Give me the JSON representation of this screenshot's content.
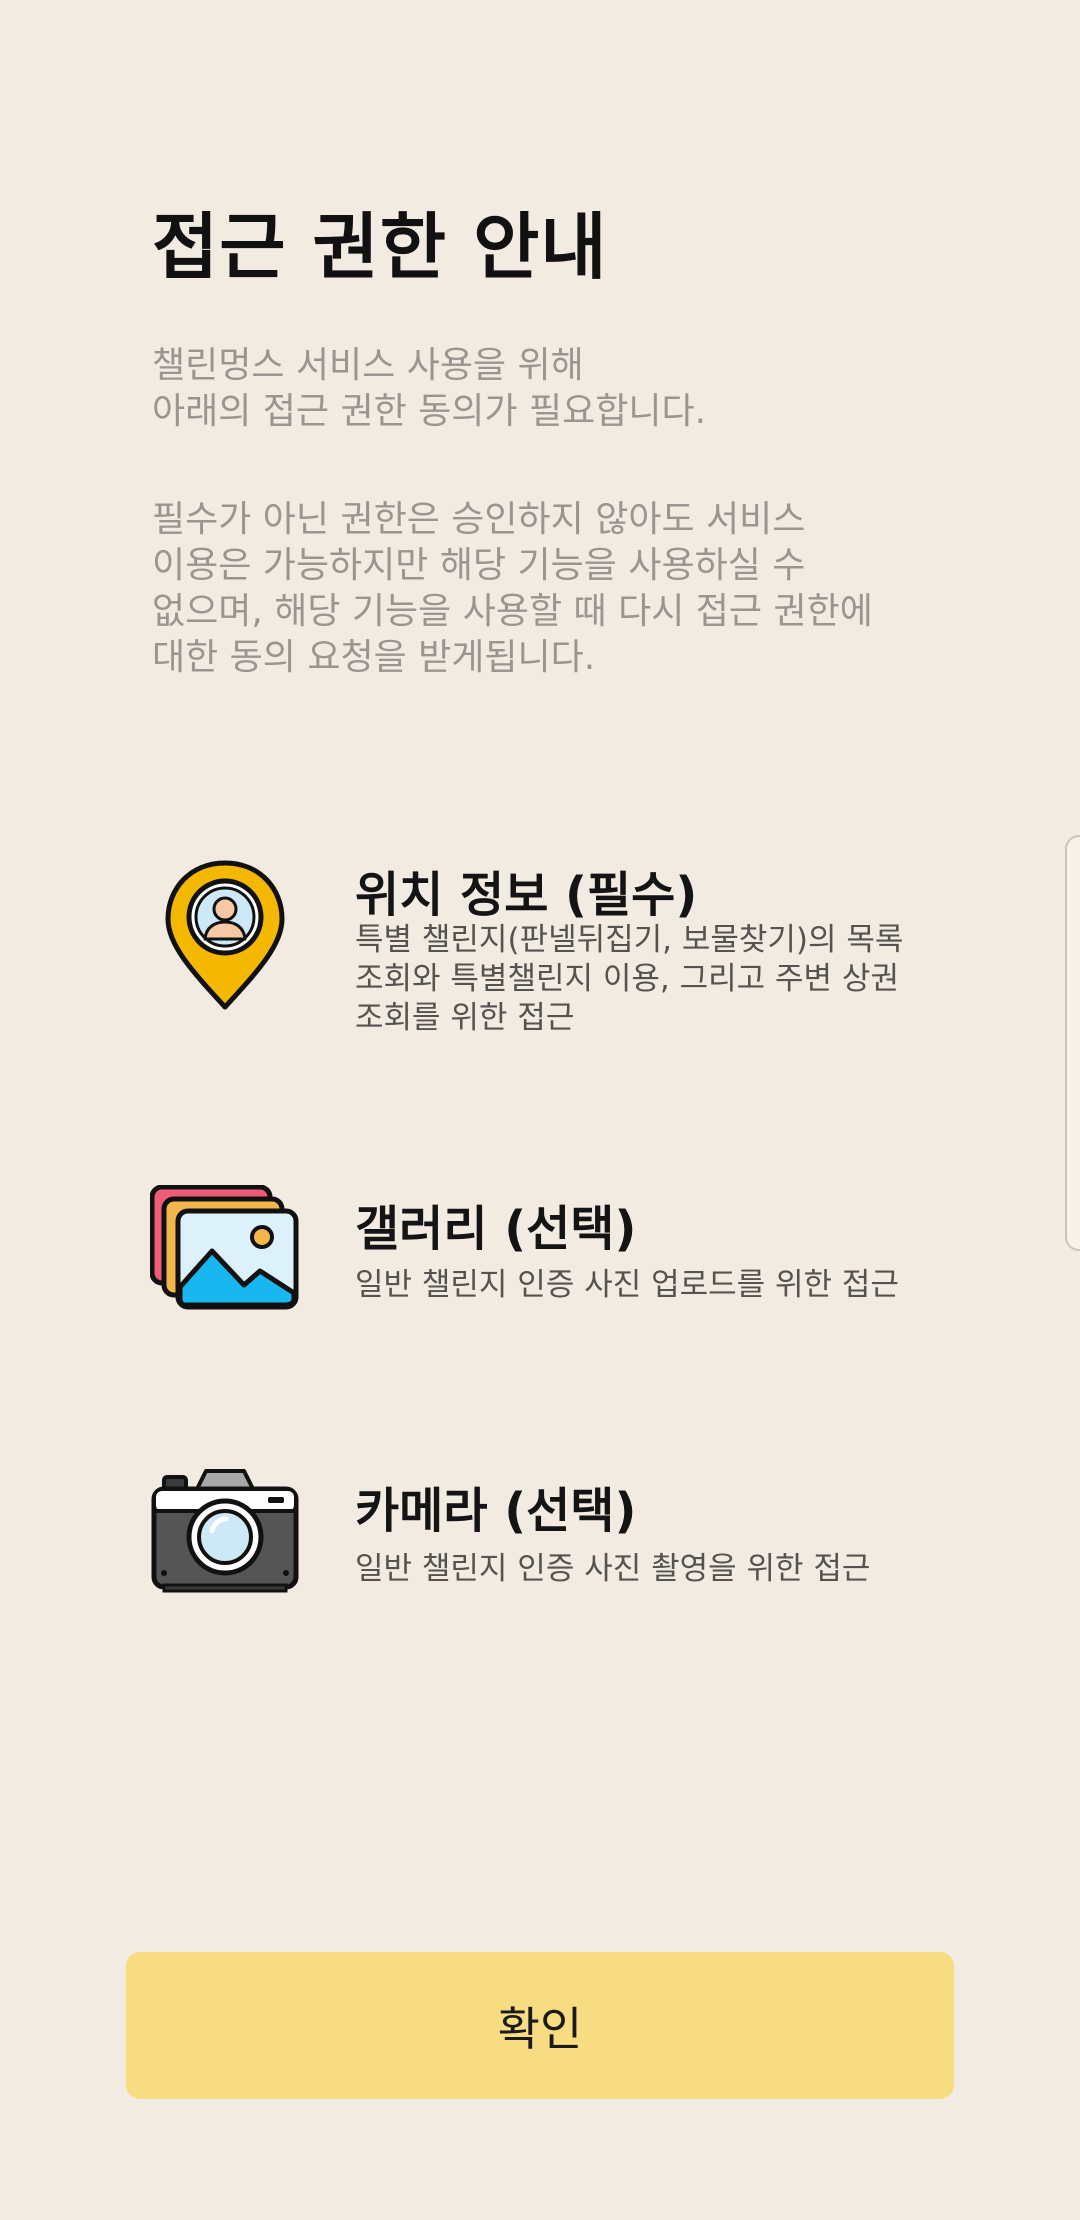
{
  "title": "접근 권한 안내",
  "intro": {
    "line1": "챌린멍스 서비스 사용을 위해",
    "line2": "아래의 접근 권한 동의가 필요합니다.",
    "note_lines": [
      "필수가 아닌 권한은 승인하지 않아도 서비스",
      "이용은 가능하지만 해당 기능을 사용하실 수",
      "없으며, 해당 기능을 사용할 때 다시 접근 권한에",
      "대한 동의 요청을 받게됩니다."
    ]
  },
  "permissions": [
    {
      "icon": "location-pin-icon",
      "title": "위치 정보 (필수)",
      "desc_lines": [
        "특별 챌린지(판넬뒤집기, 보물찾기)의 목록",
        "조회와 특별챌린지 이용, 그리고 주변 상권",
        "조회를 위한 접근"
      ]
    },
    {
      "icon": "gallery-icon",
      "title": "갤러리 (선택)",
      "desc_lines": [
        "일반 챌린지 인증 사진 업로드를 위한 접근"
      ]
    },
    {
      "icon": "camera-icon",
      "title": "카메라 (선택)",
      "desc_lines": [
        "일반 챌린지 인증 사진 촬영을 위한 접근"
      ]
    }
  ],
  "confirm_button": "확인",
  "colors": {
    "background": "#F2EBE2",
    "button": "#F7DC82",
    "pin": "#F5B800",
    "gallery_front": "#19B7F0",
    "gallery_back1": "#F2B64A",
    "gallery_back2": "#EE5C7A"
  }
}
